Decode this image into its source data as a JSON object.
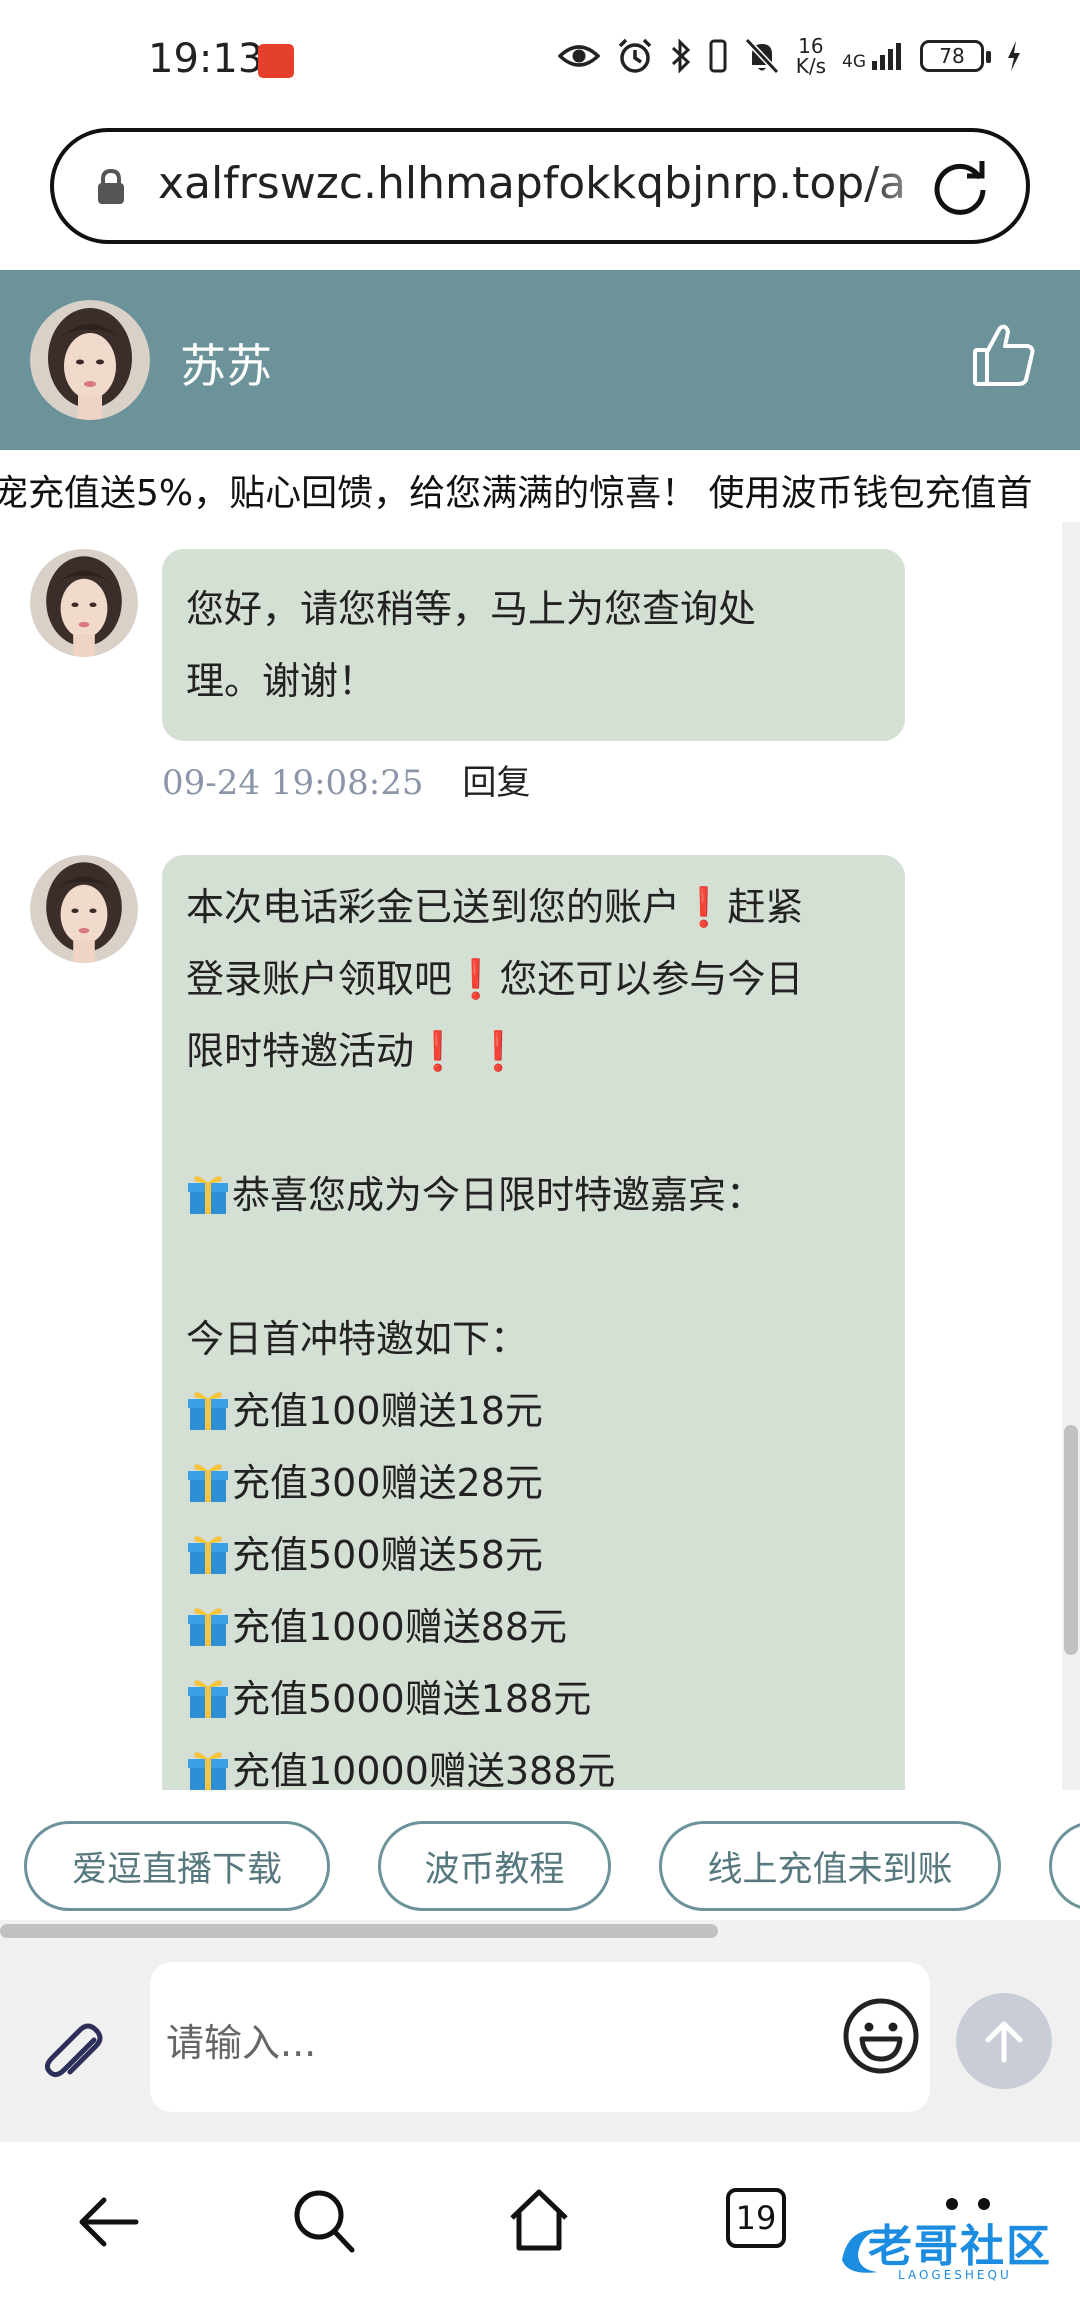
{
  "status_bar": {
    "time": "19:13",
    "net_speed_value": "16",
    "net_speed_unit": "K/s",
    "net_type": "4G",
    "battery": "78"
  },
  "browser": {
    "url": "xalfrswzc.hlhmapfokkqbjnrp.top/a"
  },
  "chat": {
    "contact_name": "苏苏",
    "marquee": "宠充值送5%，贴心回馈，给您满满的惊喜！ 使用波币钱包充值首"
  },
  "messages": [
    {
      "lines": [
        "您好，请您稍等，马上为您查询处",
        "理。谢谢！"
      ],
      "time": "09-24 19:08:25",
      "reply_label": "回复"
    },
    {
      "line1_a": "本次电话彩金已送到您的账户",
      "line1_excl": "❗",
      "line1_b": "赶紧",
      "line2_a": "登录账户领取吧",
      "line2_excl": "❗",
      "line2_b": "您还可以参与今日",
      "line3_a": "限时特邀活动",
      "line3_excl": "❗ ❗",
      "congrats": "恭喜您成为今日限时特邀嘉宾：",
      "offers_title": "今日首冲特邀如下：",
      "offers": [
        "充值100赠送18元",
        "充值300赠送28元",
        "充值500赠送58元",
        "充值1000赠送88元",
        "充值5000赠送188元",
        "充值10000赠送388元"
      ]
    }
  ],
  "quick_replies": [
    "爱逗直播下载",
    "波币教程",
    "线上充值未到账"
  ],
  "input": {
    "placeholder": "请输入..."
  },
  "nav": {
    "tab_count": "19"
  },
  "watermark": {
    "text": "老哥社区",
    "sub": "LAOGESHEQU"
  }
}
